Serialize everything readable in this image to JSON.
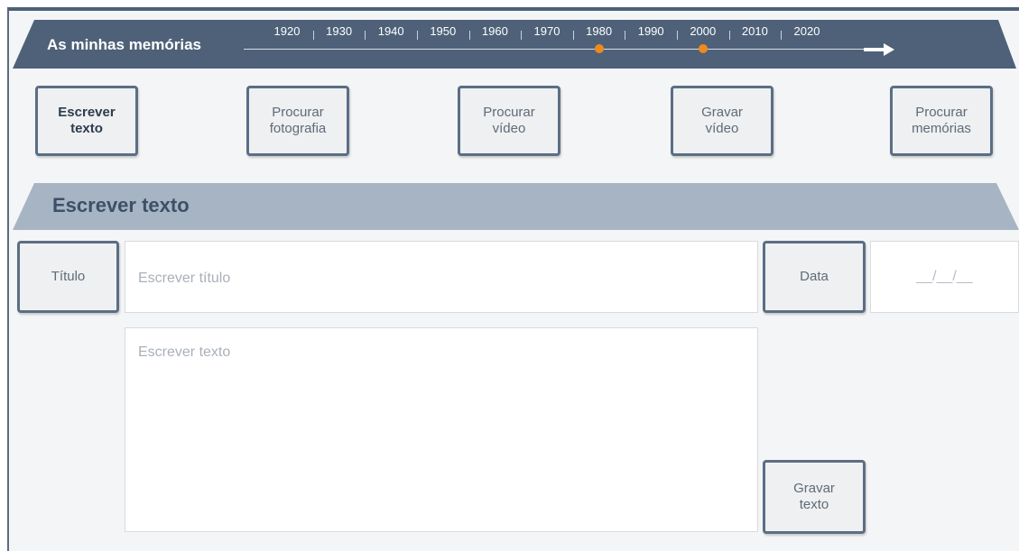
{
  "header": {
    "title": "As minhas memórias",
    "timeline": {
      "years": [
        "1920",
        "1930",
        "1940",
        "1950",
        "1960",
        "1970",
        "1980",
        "1990",
        "2000",
        "2010",
        "2020"
      ],
      "marked": [
        "1980",
        "2000"
      ],
      "marker_color": "#f08a1c"
    },
    "arrow_icon": "right-arrow-icon"
  },
  "actions": [
    {
      "label": "Escrever\ntexto",
      "active": true
    },
    {
      "label": "Procurar\nfotografia",
      "active": false
    },
    {
      "label": "Procurar\nvídeo",
      "active": false
    },
    {
      "label": "Gravar\nvídeo",
      "active": false
    },
    {
      "label": "Procurar\nmemórias",
      "active": false
    }
  ],
  "section": {
    "title": "Escrever texto"
  },
  "form": {
    "title_label": "Título",
    "title_placeholder": "Escrever título",
    "date_label": "Data",
    "date_placeholder": "__/__/__",
    "text_placeholder": "Escrever texto",
    "save_label": "Gravar\ntexto"
  },
  "colors": {
    "banner": "#4e6179",
    "section": "#a7b4c3",
    "accent": "#f08a1c"
  }
}
